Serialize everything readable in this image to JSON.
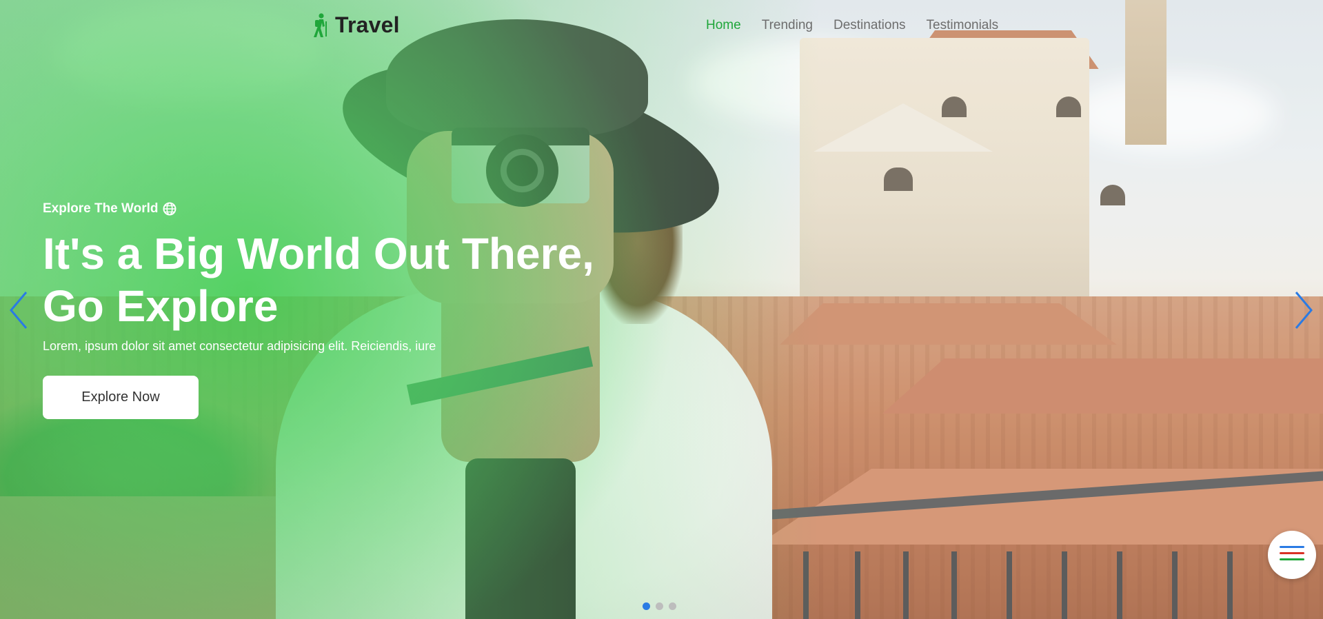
{
  "brand": {
    "name": "Travel",
    "icon": "hiker-icon",
    "accent": "#1fa63a"
  },
  "nav": {
    "items": [
      {
        "label": "Home",
        "active": true
      },
      {
        "label": "Trending",
        "active": false
      },
      {
        "label": "Destinations",
        "active": false
      },
      {
        "label": "Testimonials",
        "active": false
      }
    ]
  },
  "hero": {
    "eyebrow": "Explore The World",
    "eyebrow_icon": "globe-icon",
    "headline_line1": "It's a Big World Out There,",
    "headline_line2": "Go Explore",
    "subtext": "Lorem, ipsum dolor sit amet consectetur adipisicing elit. Reiciendis, iure",
    "cta_label": "Explore Now"
  },
  "carousel": {
    "prev_icon": "chevron-left-icon",
    "next_icon": "chevron-right-icon",
    "slide_count": 3,
    "active_slide": 1,
    "arrow_color": "#2a7be4"
  },
  "fab": {
    "icon": "menu-icon",
    "line_colors": [
      "#2a7be4",
      "#d93025",
      "#1fa63a"
    ]
  }
}
